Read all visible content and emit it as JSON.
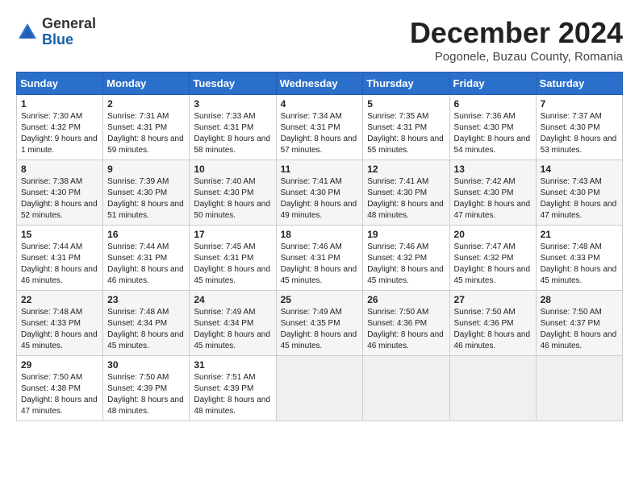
{
  "header": {
    "logo_line1": "General",
    "logo_line2": "Blue",
    "month": "December 2024",
    "location": "Pogonele, Buzau County, Romania"
  },
  "weekdays": [
    "Sunday",
    "Monday",
    "Tuesday",
    "Wednesday",
    "Thursday",
    "Friday",
    "Saturday"
  ],
  "weeks": [
    [
      {
        "day": "1",
        "sunrise": "Sunrise: 7:30 AM",
        "sunset": "Sunset: 4:32 PM",
        "daylight": "Daylight: 9 hours and 1 minute."
      },
      {
        "day": "2",
        "sunrise": "Sunrise: 7:31 AM",
        "sunset": "Sunset: 4:31 PM",
        "daylight": "Daylight: 8 hours and 59 minutes."
      },
      {
        "day": "3",
        "sunrise": "Sunrise: 7:33 AM",
        "sunset": "Sunset: 4:31 PM",
        "daylight": "Daylight: 8 hours and 58 minutes."
      },
      {
        "day": "4",
        "sunrise": "Sunrise: 7:34 AM",
        "sunset": "Sunset: 4:31 PM",
        "daylight": "Daylight: 8 hours and 57 minutes."
      },
      {
        "day": "5",
        "sunrise": "Sunrise: 7:35 AM",
        "sunset": "Sunset: 4:31 PM",
        "daylight": "Daylight: 8 hours and 55 minutes."
      },
      {
        "day": "6",
        "sunrise": "Sunrise: 7:36 AM",
        "sunset": "Sunset: 4:30 PM",
        "daylight": "Daylight: 8 hours and 54 minutes."
      },
      {
        "day": "7",
        "sunrise": "Sunrise: 7:37 AM",
        "sunset": "Sunset: 4:30 PM",
        "daylight": "Daylight: 8 hours and 53 minutes."
      }
    ],
    [
      {
        "day": "8",
        "sunrise": "Sunrise: 7:38 AM",
        "sunset": "Sunset: 4:30 PM",
        "daylight": "Daylight: 8 hours and 52 minutes."
      },
      {
        "day": "9",
        "sunrise": "Sunrise: 7:39 AM",
        "sunset": "Sunset: 4:30 PM",
        "daylight": "Daylight: 8 hours and 51 minutes."
      },
      {
        "day": "10",
        "sunrise": "Sunrise: 7:40 AM",
        "sunset": "Sunset: 4:30 PM",
        "daylight": "Daylight: 8 hours and 50 minutes."
      },
      {
        "day": "11",
        "sunrise": "Sunrise: 7:41 AM",
        "sunset": "Sunset: 4:30 PM",
        "daylight": "Daylight: 8 hours and 49 minutes."
      },
      {
        "day": "12",
        "sunrise": "Sunrise: 7:41 AM",
        "sunset": "Sunset: 4:30 PM",
        "daylight": "Daylight: 8 hours and 48 minutes."
      },
      {
        "day": "13",
        "sunrise": "Sunrise: 7:42 AM",
        "sunset": "Sunset: 4:30 PM",
        "daylight": "Daylight: 8 hours and 47 minutes."
      },
      {
        "day": "14",
        "sunrise": "Sunrise: 7:43 AM",
        "sunset": "Sunset: 4:30 PM",
        "daylight": "Daylight: 8 hours and 47 minutes."
      }
    ],
    [
      {
        "day": "15",
        "sunrise": "Sunrise: 7:44 AM",
        "sunset": "Sunset: 4:31 PM",
        "daylight": "Daylight: 8 hours and 46 minutes."
      },
      {
        "day": "16",
        "sunrise": "Sunrise: 7:44 AM",
        "sunset": "Sunset: 4:31 PM",
        "daylight": "Daylight: 8 hours and 46 minutes."
      },
      {
        "day": "17",
        "sunrise": "Sunrise: 7:45 AM",
        "sunset": "Sunset: 4:31 PM",
        "daylight": "Daylight: 8 hours and 45 minutes."
      },
      {
        "day": "18",
        "sunrise": "Sunrise: 7:46 AM",
        "sunset": "Sunset: 4:31 PM",
        "daylight": "Daylight: 8 hours and 45 minutes."
      },
      {
        "day": "19",
        "sunrise": "Sunrise: 7:46 AM",
        "sunset": "Sunset: 4:32 PM",
        "daylight": "Daylight: 8 hours and 45 minutes."
      },
      {
        "day": "20",
        "sunrise": "Sunrise: 7:47 AM",
        "sunset": "Sunset: 4:32 PM",
        "daylight": "Daylight: 8 hours and 45 minutes."
      },
      {
        "day": "21",
        "sunrise": "Sunrise: 7:48 AM",
        "sunset": "Sunset: 4:33 PM",
        "daylight": "Daylight: 8 hours and 45 minutes."
      }
    ],
    [
      {
        "day": "22",
        "sunrise": "Sunrise: 7:48 AM",
        "sunset": "Sunset: 4:33 PM",
        "daylight": "Daylight: 8 hours and 45 minutes."
      },
      {
        "day": "23",
        "sunrise": "Sunrise: 7:48 AM",
        "sunset": "Sunset: 4:34 PM",
        "daylight": "Daylight: 8 hours and 45 minutes."
      },
      {
        "day": "24",
        "sunrise": "Sunrise: 7:49 AM",
        "sunset": "Sunset: 4:34 PM",
        "daylight": "Daylight: 8 hours and 45 minutes."
      },
      {
        "day": "25",
        "sunrise": "Sunrise: 7:49 AM",
        "sunset": "Sunset: 4:35 PM",
        "daylight": "Daylight: 8 hours and 45 minutes."
      },
      {
        "day": "26",
        "sunrise": "Sunrise: 7:50 AM",
        "sunset": "Sunset: 4:36 PM",
        "daylight": "Daylight: 8 hours and 46 minutes."
      },
      {
        "day": "27",
        "sunrise": "Sunrise: 7:50 AM",
        "sunset": "Sunset: 4:36 PM",
        "daylight": "Daylight: 8 hours and 46 minutes."
      },
      {
        "day": "28",
        "sunrise": "Sunrise: 7:50 AM",
        "sunset": "Sunset: 4:37 PM",
        "daylight": "Daylight: 8 hours and 46 minutes."
      }
    ],
    [
      {
        "day": "29",
        "sunrise": "Sunrise: 7:50 AM",
        "sunset": "Sunset: 4:38 PM",
        "daylight": "Daylight: 8 hours and 47 minutes."
      },
      {
        "day": "30",
        "sunrise": "Sunrise: 7:50 AM",
        "sunset": "Sunset: 4:39 PM",
        "daylight": "Daylight: 8 hours and 48 minutes."
      },
      {
        "day": "31",
        "sunrise": "Sunrise: 7:51 AM",
        "sunset": "Sunset: 4:39 PM",
        "daylight": "Daylight: 8 hours and 48 minutes."
      },
      null,
      null,
      null,
      null
    ]
  ]
}
